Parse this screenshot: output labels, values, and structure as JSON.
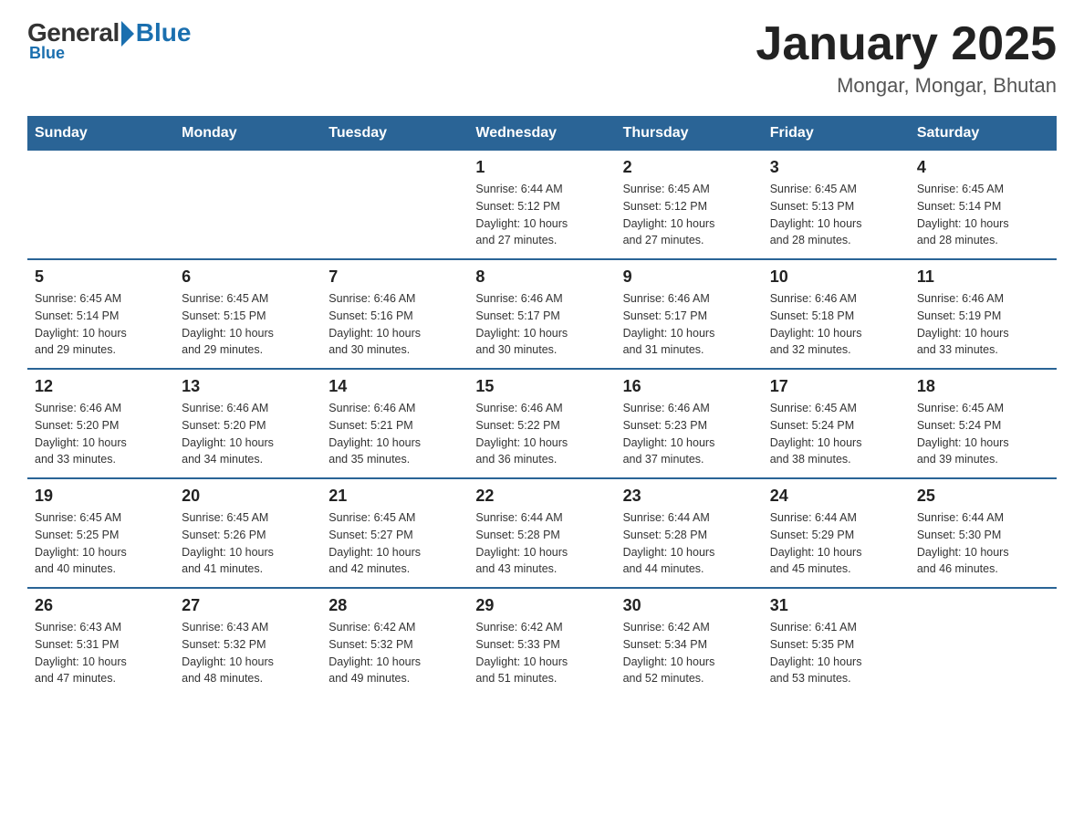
{
  "header": {
    "logo_general": "General",
    "logo_blue": "Blue",
    "main_title": "January 2025",
    "subtitle": "Mongar, Mongar, Bhutan"
  },
  "calendar": {
    "days_of_week": [
      "Sunday",
      "Monday",
      "Tuesday",
      "Wednesday",
      "Thursday",
      "Friday",
      "Saturday"
    ],
    "weeks": [
      [
        {
          "day": "",
          "info": ""
        },
        {
          "day": "",
          "info": ""
        },
        {
          "day": "",
          "info": ""
        },
        {
          "day": "1",
          "info": "Sunrise: 6:44 AM\nSunset: 5:12 PM\nDaylight: 10 hours\nand 27 minutes."
        },
        {
          "day": "2",
          "info": "Sunrise: 6:45 AM\nSunset: 5:12 PM\nDaylight: 10 hours\nand 27 minutes."
        },
        {
          "day": "3",
          "info": "Sunrise: 6:45 AM\nSunset: 5:13 PM\nDaylight: 10 hours\nand 28 minutes."
        },
        {
          "day": "4",
          "info": "Sunrise: 6:45 AM\nSunset: 5:14 PM\nDaylight: 10 hours\nand 28 minutes."
        }
      ],
      [
        {
          "day": "5",
          "info": "Sunrise: 6:45 AM\nSunset: 5:14 PM\nDaylight: 10 hours\nand 29 minutes."
        },
        {
          "day": "6",
          "info": "Sunrise: 6:45 AM\nSunset: 5:15 PM\nDaylight: 10 hours\nand 29 minutes."
        },
        {
          "day": "7",
          "info": "Sunrise: 6:46 AM\nSunset: 5:16 PM\nDaylight: 10 hours\nand 30 minutes."
        },
        {
          "day": "8",
          "info": "Sunrise: 6:46 AM\nSunset: 5:17 PM\nDaylight: 10 hours\nand 30 minutes."
        },
        {
          "day": "9",
          "info": "Sunrise: 6:46 AM\nSunset: 5:17 PM\nDaylight: 10 hours\nand 31 minutes."
        },
        {
          "day": "10",
          "info": "Sunrise: 6:46 AM\nSunset: 5:18 PM\nDaylight: 10 hours\nand 32 minutes."
        },
        {
          "day": "11",
          "info": "Sunrise: 6:46 AM\nSunset: 5:19 PM\nDaylight: 10 hours\nand 33 minutes."
        }
      ],
      [
        {
          "day": "12",
          "info": "Sunrise: 6:46 AM\nSunset: 5:20 PM\nDaylight: 10 hours\nand 33 minutes."
        },
        {
          "day": "13",
          "info": "Sunrise: 6:46 AM\nSunset: 5:20 PM\nDaylight: 10 hours\nand 34 minutes."
        },
        {
          "day": "14",
          "info": "Sunrise: 6:46 AM\nSunset: 5:21 PM\nDaylight: 10 hours\nand 35 minutes."
        },
        {
          "day": "15",
          "info": "Sunrise: 6:46 AM\nSunset: 5:22 PM\nDaylight: 10 hours\nand 36 minutes."
        },
        {
          "day": "16",
          "info": "Sunrise: 6:46 AM\nSunset: 5:23 PM\nDaylight: 10 hours\nand 37 minutes."
        },
        {
          "day": "17",
          "info": "Sunrise: 6:45 AM\nSunset: 5:24 PM\nDaylight: 10 hours\nand 38 minutes."
        },
        {
          "day": "18",
          "info": "Sunrise: 6:45 AM\nSunset: 5:24 PM\nDaylight: 10 hours\nand 39 minutes."
        }
      ],
      [
        {
          "day": "19",
          "info": "Sunrise: 6:45 AM\nSunset: 5:25 PM\nDaylight: 10 hours\nand 40 minutes."
        },
        {
          "day": "20",
          "info": "Sunrise: 6:45 AM\nSunset: 5:26 PM\nDaylight: 10 hours\nand 41 minutes."
        },
        {
          "day": "21",
          "info": "Sunrise: 6:45 AM\nSunset: 5:27 PM\nDaylight: 10 hours\nand 42 minutes."
        },
        {
          "day": "22",
          "info": "Sunrise: 6:44 AM\nSunset: 5:28 PM\nDaylight: 10 hours\nand 43 minutes."
        },
        {
          "day": "23",
          "info": "Sunrise: 6:44 AM\nSunset: 5:28 PM\nDaylight: 10 hours\nand 44 minutes."
        },
        {
          "day": "24",
          "info": "Sunrise: 6:44 AM\nSunset: 5:29 PM\nDaylight: 10 hours\nand 45 minutes."
        },
        {
          "day": "25",
          "info": "Sunrise: 6:44 AM\nSunset: 5:30 PM\nDaylight: 10 hours\nand 46 minutes."
        }
      ],
      [
        {
          "day": "26",
          "info": "Sunrise: 6:43 AM\nSunset: 5:31 PM\nDaylight: 10 hours\nand 47 minutes."
        },
        {
          "day": "27",
          "info": "Sunrise: 6:43 AM\nSunset: 5:32 PM\nDaylight: 10 hours\nand 48 minutes."
        },
        {
          "day": "28",
          "info": "Sunrise: 6:42 AM\nSunset: 5:32 PM\nDaylight: 10 hours\nand 49 minutes."
        },
        {
          "day": "29",
          "info": "Sunrise: 6:42 AM\nSunset: 5:33 PM\nDaylight: 10 hours\nand 51 minutes."
        },
        {
          "day": "30",
          "info": "Sunrise: 6:42 AM\nSunset: 5:34 PM\nDaylight: 10 hours\nand 52 minutes."
        },
        {
          "day": "31",
          "info": "Sunrise: 6:41 AM\nSunset: 5:35 PM\nDaylight: 10 hours\nand 53 minutes."
        },
        {
          "day": "",
          "info": ""
        }
      ]
    ]
  }
}
